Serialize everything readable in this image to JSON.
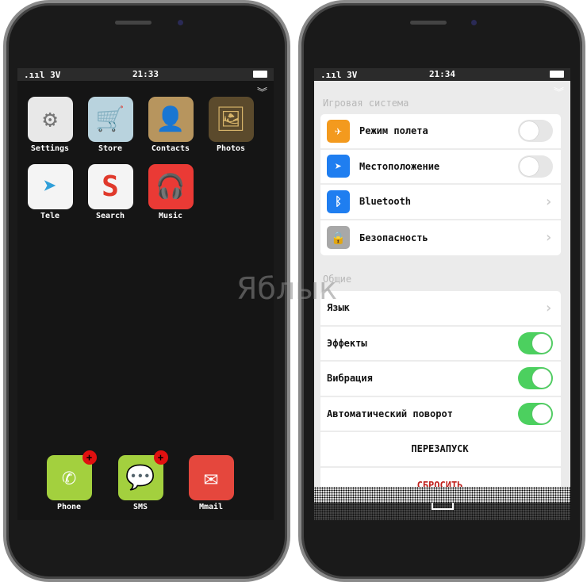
{
  "watermark": "Яблык",
  "left": {
    "status": {
      "signal": ".ııl 3V",
      "time": "21:33"
    },
    "apps": [
      {
        "label": "Settings",
        "icon": "gear-icon",
        "glyph": "⚙",
        "bg": "#e8e8e8",
        "fg": "#777"
      },
      {
        "label": "Store",
        "icon": "cart-icon",
        "glyph": "🛒",
        "bg": "#b9d3de",
        "fg": "#fff"
      },
      {
        "label": "Contacts",
        "icon": "person-icon",
        "glyph": "👤",
        "bg": "#b7955e",
        "fg": "#5a3d22"
      },
      {
        "label": "Photos",
        "icon": "mona-lisa-icon",
        "glyph": "🖼",
        "bg": "#5b4a2c",
        "fg": "#d7b46a"
      },
      {
        "label": "Tele",
        "icon": "paper-plane-icon",
        "glyph": "➤",
        "bg": "#f4f4f4",
        "fg": "#2f9fd9"
      },
      {
        "label": "Search",
        "icon": "s-logo-icon",
        "glyph": "S",
        "bg": "#f4f4f4",
        "fg": "#e0392b"
      },
      {
        "label": "Music",
        "icon": "headphones-icon",
        "glyph": "🎧",
        "bg": "#ea3a35",
        "fg": "#fff"
      }
    ],
    "dock": [
      {
        "label": "Phone",
        "icon": "phone-icon",
        "glyph": "✆",
        "bg": "#a3d03e",
        "badge": "+"
      },
      {
        "label": "SMS",
        "icon": "message-icon",
        "glyph": "💬",
        "bg": "#a3d03e",
        "badge": "+"
      },
      {
        "label": "Mmail",
        "icon": "envelope-icon",
        "glyph": "✉",
        "bg": "#e5473d"
      }
    ]
  },
  "right": {
    "status": {
      "signal": ".ııl 3V",
      "time": "21:34"
    },
    "section1": "Игровая система",
    "rows1": [
      {
        "label": "Режим полета",
        "icon": "airplane-icon",
        "glyph": "✈",
        "color": "#f39a1e",
        "control": "toggle",
        "on": false
      },
      {
        "label": "Местоположение",
        "icon": "location-arrow-icon",
        "glyph": "➤",
        "color": "#1f7ef0",
        "control": "toggle",
        "on": false
      },
      {
        "label": "Bluetooth",
        "icon": "bluetooth-icon",
        "glyph": "ᛒ",
        "color": "#1f7ef0",
        "control": "arrow"
      },
      {
        "label": "Безопасность",
        "icon": "lock-icon",
        "glyph": "🔒",
        "color": "#a8a8a8",
        "control": "arrow"
      }
    ],
    "section2": "Общие",
    "rows2": [
      {
        "label": "Язык",
        "control": "arrow"
      },
      {
        "label": "Эффекты",
        "control": "toggle",
        "on": true
      },
      {
        "label": "Вибрация",
        "control": "toggle",
        "on": true
      },
      {
        "label": "Автоматический поворот",
        "control": "toggle",
        "on": true
      }
    ],
    "restart": "ПЕРЕЗАПУСК",
    "reset": "СБРОСИТЬ",
    "reset_color": "#c0201c",
    "toggle_on_color": "#4cd05f"
  }
}
